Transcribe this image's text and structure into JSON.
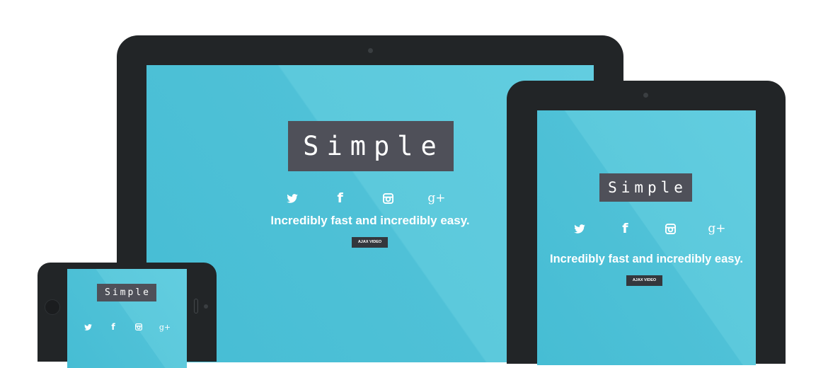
{
  "brand": "Simple",
  "tagline": "Incredibly fast and incredibly easy.",
  "button_label": "AJAX VIDEO",
  "social_icons": [
    "twitter-icon",
    "facebook-icon",
    "instagram-icon",
    "google-plus-icon"
  ],
  "social_glyphs": {
    "facebook": "f",
    "google_plus": "g+"
  },
  "colors": {
    "device_frame": "#222527",
    "screen": "#5cc9dc",
    "logo_box": "#4f5059",
    "button": "#34373d",
    "text": "#ffffff"
  }
}
